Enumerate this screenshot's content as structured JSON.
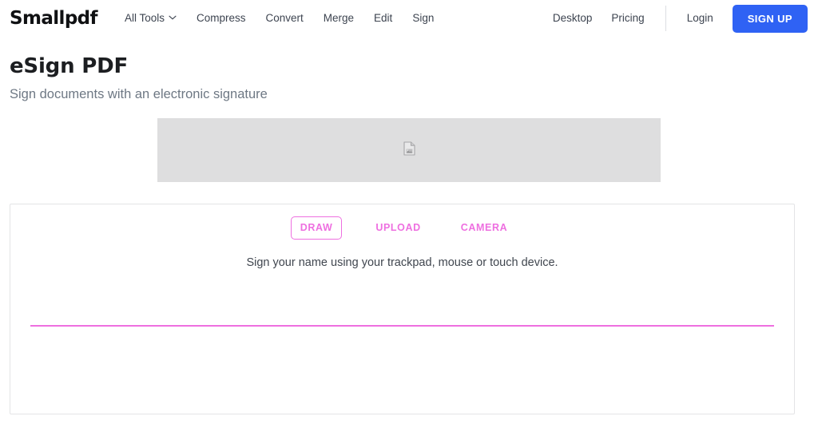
{
  "navbar": {
    "logo": "Smallpdf",
    "left_items": [
      {
        "label": "All Tools",
        "icon": "chevron-down-icon",
        "has_chevron": true
      },
      {
        "label": "Compress",
        "has_chevron": false
      },
      {
        "label": "Convert",
        "has_chevron": false
      },
      {
        "label": "Merge",
        "has_chevron": false
      },
      {
        "label": "Edit",
        "has_chevron": false
      },
      {
        "label": "Sign",
        "has_chevron": false
      }
    ],
    "right_items": [
      {
        "label": "Desktop"
      },
      {
        "label": "Pricing"
      }
    ],
    "login_label": "Login",
    "signup_label": "SIGN UP",
    "signup_color": "#2f62f4"
  },
  "page": {
    "title": "eSign PDF",
    "subtitle": "Sign documents with an electronic signature"
  },
  "preview": {
    "icon": "document-icon",
    "background_color": "#dededf"
  },
  "signature_panel": {
    "tabs": [
      {
        "label": "DRAW",
        "active": true
      },
      {
        "label": "UPLOAD",
        "active": false
      },
      {
        "label": "CAMERA",
        "active": false
      }
    ],
    "hint": "Sign your name using your trackpad, mouse or touch device.",
    "accent_color": "#ee6fe0"
  }
}
